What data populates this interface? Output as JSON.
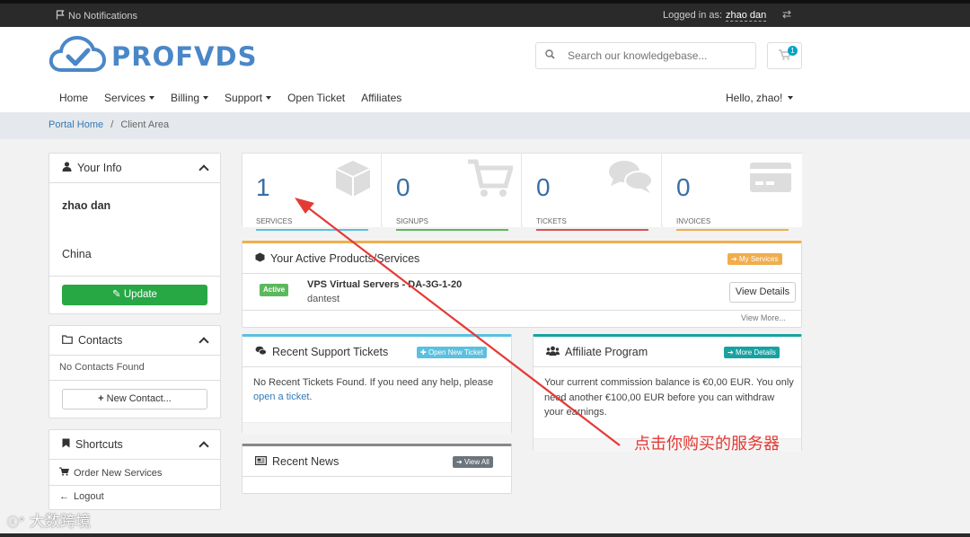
{
  "topbar": {
    "notifications": "No Notifications",
    "logged_in_as": "Logged in as:",
    "username": "zhao dan"
  },
  "header": {
    "brand": "PROFVDS",
    "search_placeholder": "Search our knowledgebase...",
    "cart_count": "1"
  },
  "nav": {
    "items": [
      "Home",
      "Services",
      "Billing",
      "Support",
      "Open Ticket",
      "Affiliates"
    ],
    "hello": "Hello, zhao!"
  },
  "breadcrumb": {
    "home": "Portal Home",
    "sep": "/",
    "current": "Client Area"
  },
  "sidebar": {
    "your_info": {
      "title": "Your Info",
      "name": "zhao dan",
      "country": "China",
      "update": "Update"
    },
    "contacts": {
      "title": "Contacts",
      "empty": "No Contacts Found",
      "new": "New Contact..."
    },
    "shortcuts": {
      "title": "Shortcuts",
      "items": [
        "Order New Services",
        "Logout"
      ]
    }
  },
  "stats": [
    {
      "value": "1",
      "label": "SERVICES",
      "color": "#5bc0de"
    },
    {
      "value": "0",
      "label": "SIGNUPS",
      "color": "#5cb85c"
    },
    {
      "value": "0",
      "label": "TICKETS",
      "color": "#d9534f"
    },
    {
      "value": "0",
      "label": "INVOICES",
      "color": "#f0ad4e"
    }
  ],
  "products": {
    "title": "Your Active Products/Services",
    "my_services": "My Services",
    "status": "Active",
    "name": "VPS Virtual Servers - DA-3G-1-20",
    "domain": "dantest",
    "view_details": "View Details",
    "view_more": "View More..."
  },
  "tickets": {
    "title": "Recent Support Tickets",
    "open_new": "Open New Ticket",
    "text": "No Recent Tickets Found. If you need any help, please",
    "link": "open a ticket",
    "period": "."
  },
  "affiliate": {
    "title": "Affiliate Program",
    "more": "More Details",
    "text": "Your current commission balance is €0,00 EUR. You only need another €100,00 EUR before you can withdraw your earnings."
  },
  "news": {
    "title": "Recent News",
    "view_all": "View All"
  },
  "annotation": {
    "text": "点击你购买的服务器",
    "color": "#e53935"
  },
  "watermark": "大数跨境"
}
